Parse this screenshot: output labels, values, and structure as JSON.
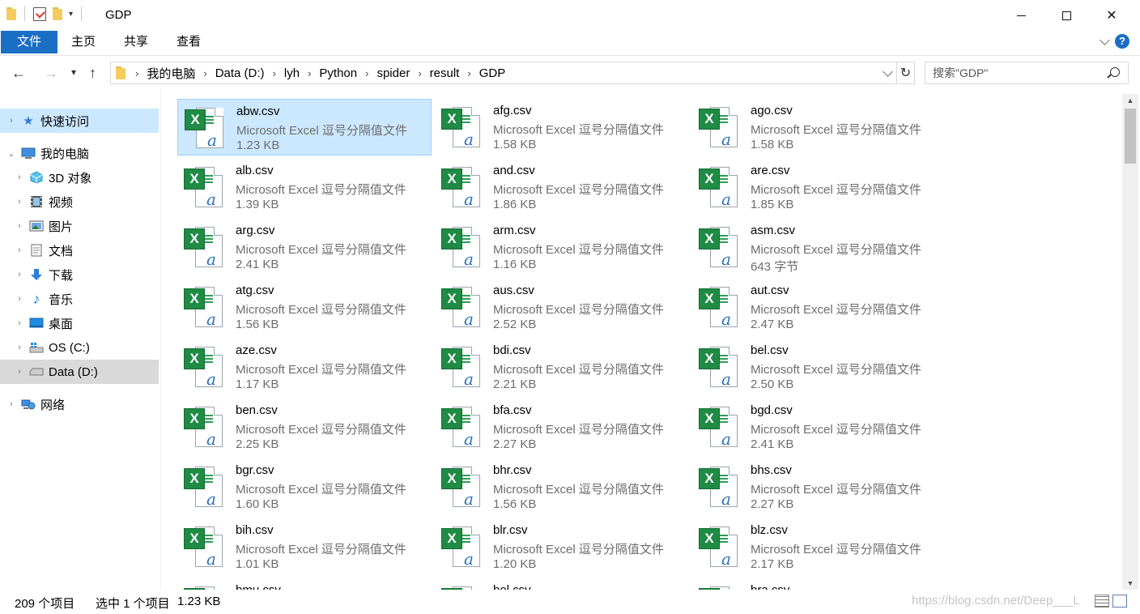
{
  "window": {
    "title": "GDP",
    "min_glyph": "minimize",
    "max_glyph": "maximize",
    "close_glyph": "✕"
  },
  "ribbon": {
    "tabs": [
      "文件",
      "主页",
      "共享",
      "查看"
    ],
    "help": "?"
  },
  "address": {
    "breadcrumbs": [
      "我的电脑",
      "Data (D:)",
      "lyh",
      "Python",
      "spider",
      "result",
      "GDP"
    ],
    "separator": "›"
  },
  "search": {
    "placeholder": "搜索\"GDP\""
  },
  "nav": {
    "back": "←",
    "forward": "→",
    "recent": "⌄",
    "up": "↑",
    "refresh": "↻"
  },
  "sidebar": {
    "items": [
      {
        "label": "快速访问",
        "icon": "star-icon",
        "expand": "›"
      },
      {
        "label": "我的电脑",
        "icon": "computer-icon",
        "expand": "⌄"
      },
      {
        "label": "3D 对象",
        "icon": "3d-objects-icon",
        "expand": "›"
      },
      {
        "label": "视频",
        "icon": "video-icon",
        "expand": "›"
      },
      {
        "label": "图片",
        "icon": "pictures-icon",
        "expand": "›"
      },
      {
        "label": "文档",
        "icon": "documents-icon",
        "expand": "›"
      },
      {
        "label": "下载",
        "icon": "download-icon",
        "expand": "›"
      },
      {
        "label": "音乐",
        "icon": "music-icon",
        "expand": "›"
      },
      {
        "label": "桌面",
        "icon": "desktop-icon",
        "expand": "›"
      },
      {
        "label": "OS (C:)",
        "icon": "drive-c-icon",
        "expand": "›"
      },
      {
        "label": "Data (D:)",
        "icon": "drive-d-icon",
        "expand": "›"
      },
      {
        "label": "网络",
        "icon": "network-icon",
        "expand": "›"
      }
    ]
  },
  "files": [
    {
      "name": "abw.csv",
      "type": "Microsoft Excel 逗号分隔值文件",
      "size": "1.23 KB"
    },
    {
      "name": "afg.csv",
      "type": "Microsoft Excel 逗号分隔值文件",
      "size": "1.58 KB"
    },
    {
      "name": "ago.csv",
      "type": "Microsoft Excel 逗号分隔值文件",
      "size": "1.58 KB"
    },
    {
      "name": "alb.csv",
      "type": "Microsoft Excel 逗号分隔值文件",
      "size": "1.39 KB"
    },
    {
      "name": "and.csv",
      "type": "Microsoft Excel 逗号分隔值文件",
      "size": "1.86 KB"
    },
    {
      "name": "are.csv",
      "type": "Microsoft Excel 逗号分隔值文件",
      "size": "1.85 KB"
    },
    {
      "name": "arg.csv",
      "type": "Microsoft Excel 逗号分隔值文件",
      "size": "2.41 KB"
    },
    {
      "name": "arm.csv",
      "type": "Microsoft Excel 逗号分隔值文件",
      "size": "1.16 KB"
    },
    {
      "name": "asm.csv",
      "type": "Microsoft Excel 逗号分隔值文件",
      "size": "643 字节"
    },
    {
      "name": "atg.csv",
      "type": "Microsoft Excel 逗号分隔值文件",
      "size": "1.56 KB"
    },
    {
      "name": "aus.csv",
      "type": "Microsoft Excel 逗号分隔值文件",
      "size": "2.52 KB"
    },
    {
      "name": "aut.csv",
      "type": "Microsoft Excel 逗号分隔值文件",
      "size": "2.47 KB"
    },
    {
      "name": "aze.csv",
      "type": "Microsoft Excel 逗号分隔值文件",
      "size": "1.17 KB"
    },
    {
      "name": "bdi.csv",
      "type": "Microsoft Excel 逗号分隔值文件",
      "size": "2.21 KB"
    },
    {
      "name": "bel.csv",
      "type": "Microsoft Excel 逗号分隔值文件",
      "size": "2.50 KB"
    },
    {
      "name": "ben.csv",
      "type": "Microsoft Excel 逗号分隔值文件",
      "size": "2.25 KB"
    },
    {
      "name": "bfa.csv",
      "type": "Microsoft Excel 逗号分隔值文件",
      "size": "2.27 KB"
    },
    {
      "name": "bgd.csv",
      "type": "Microsoft Excel 逗号分隔值文件",
      "size": "2.41 KB"
    },
    {
      "name": "bgr.csv",
      "type": "Microsoft Excel 逗号分隔值文件",
      "size": "1.60 KB"
    },
    {
      "name": "bhr.csv",
      "type": "Microsoft Excel 逗号分隔值文件",
      "size": "1.56 KB"
    },
    {
      "name": "bhs.csv",
      "type": "Microsoft Excel 逗号分隔值文件",
      "size": "2.27 KB"
    },
    {
      "name": "bih.csv",
      "type": "Microsoft Excel 逗号分隔值文件",
      "size": "1.01 KB"
    },
    {
      "name": "blr.csv",
      "type": "Microsoft Excel 逗号分隔值文件",
      "size": "1.20 KB"
    },
    {
      "name": "blz.csv",
      "type": "Microsoft Excel 逗号分隔值文件",
      "size": "2.17 KB"
    },
    {
      "name": "bmu.csv",
      "type": "",
      "size": ""
    },
    {
      "name": "bol.csv",
      "type": "",
      "size": ""
    },
    {
      "name": "bra.csv",
      "type": "",
      "size": ""
    }
  ],
  "selected_file_index": 0,
  "status": {
    "count": "209 个项目",
    "selected": "选中 1 个项目",
    "size": "1.23 KB"
  },
  "watermark": "https://blog.csdn.net/Deep___L",
  "colors": {
    "accent": "#1a6fc4",
    "selection": "#cce8ff",
    "excel_green": "#1f8b44"
  }
}
